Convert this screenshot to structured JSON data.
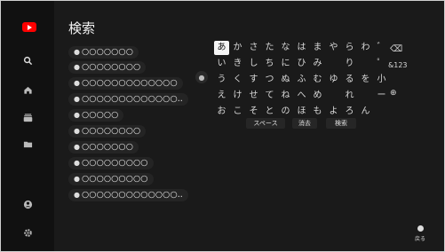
{
  "sidebar": {
    "logo_icon": "youtube-logo-icon",
    "items": [
      {
        "name": "search-icon"
      },
      {
        "name": "home-icon"
      },
      {
        "name": "subscriptions-icon"
      },
      {
        "name": "library-icon"
      },
      {
        "name": "account-icon"
      },
      {
        "name": "settings-icon"
      }
    ]
  },
  "header": {
    "title": "検索"
  },
  "suggestions": [
    {
      "label": "○○○○○○○"
    },
    {
      "label": "○○○○○○○○"
    },
    {
      "label": "○○○○○○○○○○○○○"
    },
    {
      "label": "○○○○○○○○○○○○○.."
    },
    {
      "label": "○○○○○"
    },
    {
      "label": "○○○○○○○○"
    },
    {
      "label": "○○○○○○○"
    },
    {
      "label": "○○○○○○○○○"
    },
    {
      "label": "○○○○○○○○○"
    },
    {
      "label": "○○○○○○○○○○○○○.."
    }
  ],
  "keyboard": {
    "rows": [
      [
        "あ",
        "か",
        "さ",
        "た",
        "な",
        "は",
        "ま",
        "や",
        "ら",
        "わ",
        "゛"
      ],
      [
        "い",
        "き",
        "し",
        "ち",
        "に",
        "ひ",
        "み",
        "",
        "り",
        "",
        "゜"
      ],
      [
        "う",
        "く",
        "す",
        "つ",
        "ぬ",
        "ふ",
        "む",
        "ゆ",
        "る",
        "を",
        "小"
      ],
      [
        "え",
        "け",
        "せ",
        "て",
        "ね",
        "へ",
        "め",
        "",
        "れ",
        "",
        "ー"
      ],
      [
        "お",
        "こ",
        "そ",
        "と",
        "の",
        "ほ",
        "も",
        "よ",
        "ろ",
        "ん",
        ""
      ]
    ],
    "selected_key": "あ",
    "backspace_label": "⌫",
    "mode_label": "&123",
    "extra_key": "⊕",
    "actions": [
      {
        "label": "スペース"
      },
      {
        "label": "消去"
      },
      {
        "label": "検索"
      }
    ]
  },
  "footer": {
    "back_label": "戻る"
  }
}
